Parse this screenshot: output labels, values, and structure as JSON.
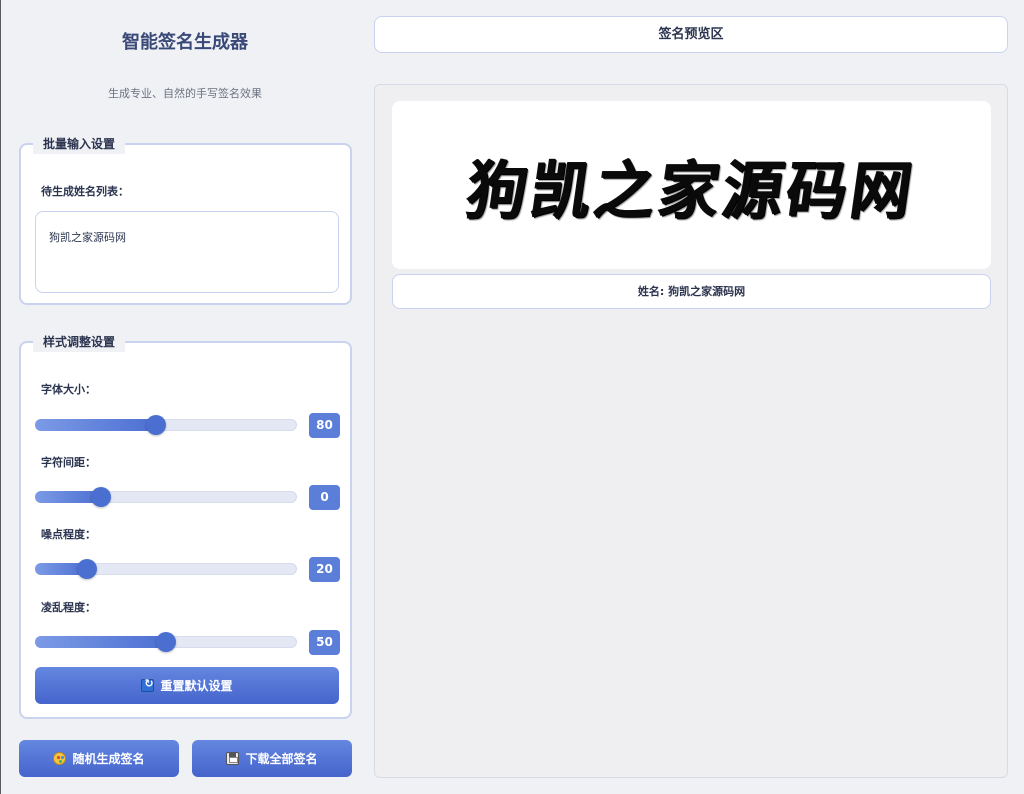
{
  "app": {
    "title": "智能签名生成器",
    "subtitle": "生成专业、自然的手写签名效果"
  },
  "batch_input": {
    "legend": "批量输入设置",
    "label": "待生成姓名列表：",
    "value": "狗凯之家源码网"
  },
  "style_settings": {
    "legend": "样式调整设置",
    "sliders": [
      {
        "label": "字体大小：",
        "value": 80,
        "min": 20,
        "max": 150
      },
      {
        "label": "字符间距：",
        "value": 0,
        "min": -20,
        "max": 60
      },
      {
        "label": "噪点程度：",
        "value": 20,
        "min": 0,
        "max": 100
      },
      {
        "label": "凌乱程度：",
        "value": 50,
        "min": 0,
        "max": 100
      }
    ],
    "reset_label": "重置默认设置"
  },
  "actions": {
    "random_label": "随机生成签名",
    "download_label": "下载全部签名"
  },
  "preview": {
    "header": "签名预览区",
    "signature_text": "狗凯之家源码网",
    "caption": "姓名: 狗凯之家源码网"
  },
  "colors": {
    "accent": "#4a6fd1",
    "value_box": "#5b7ed8",
    "title": "#3a4a78"
  },
  "icons": {
    "reset": "refresh-icon",
    "random": "palette-icon",
    "download": "save-icon"
  }
}
